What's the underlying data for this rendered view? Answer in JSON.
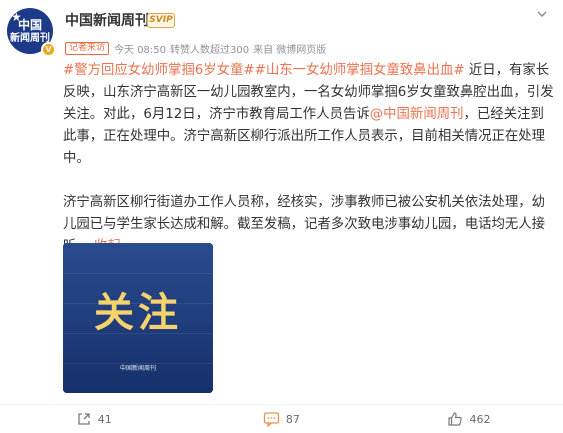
{
  "colors": {
    "accent": "#eb7350",
    "name": "#333333",
    "meta": "#939393",
    "avatar_bg": "#1d3a8a",
    "image_bg": "#1f3b78",
    "image_title": "#f7d36b"
  },
  "post": {
    "author": {
      "avatar_line1": "中国",
      "avatar_line2": "新闻周刊",
      "verified_icon": "verified-v-badge",
      "name": "中国新闻周刊",
      "badge_icon": "vip-badge",
      "menu_icon": "chevron-down-icon"
    },
    "meta": {
      "tag": "记者来访",
      "time": "今天 08:50",
      "reads": "转赞人数超过300",
      "source": "来自 微博网页版"
    },
    "text": {
      "hashtag1": "#警方回应女幼师掌掴6岁女童#",
      "hashtag2": "#山东一女幼师掌掴女童致鼻出血#",
      "p1_a": " 近日，有家长反映，山东济宁高新区一幼儿园教室内，一名女幼师掌掴6岁女童致鼻腔出血，引发关注。对此，6月12日，济宁市教育局工作人员告诉",
      "mention": "@中国新闻周刊",
      "p1_b": "，已经关注到此事，正在处理中。济宁高新区柳行派出所工作人员表示，目前相关情况正在处理中。",
      "p2": "济宁高新区柳行街道办工作人员称，经核实，涉事教师已被公安机关依法处理，幼儿园已与学生家长达成和解。截至发稿，记者多次致电涉事幼儿园，电话均无人接听。",
      "fold": "收起",
      "fold_icon": "chevron-up-icon"
    },
    "image": {
      "title": "关注",
      "caption": "中国新闻周刊"
    },
    "actions": {
      "share_icon": "share-icon",
      "share_count": "41",
      "comment_icon": "comment-icon",
      "comment_count": "87",
      "like_icon": "thumbs-up-icon",
      "like_count": "462"
    }
  }
}
